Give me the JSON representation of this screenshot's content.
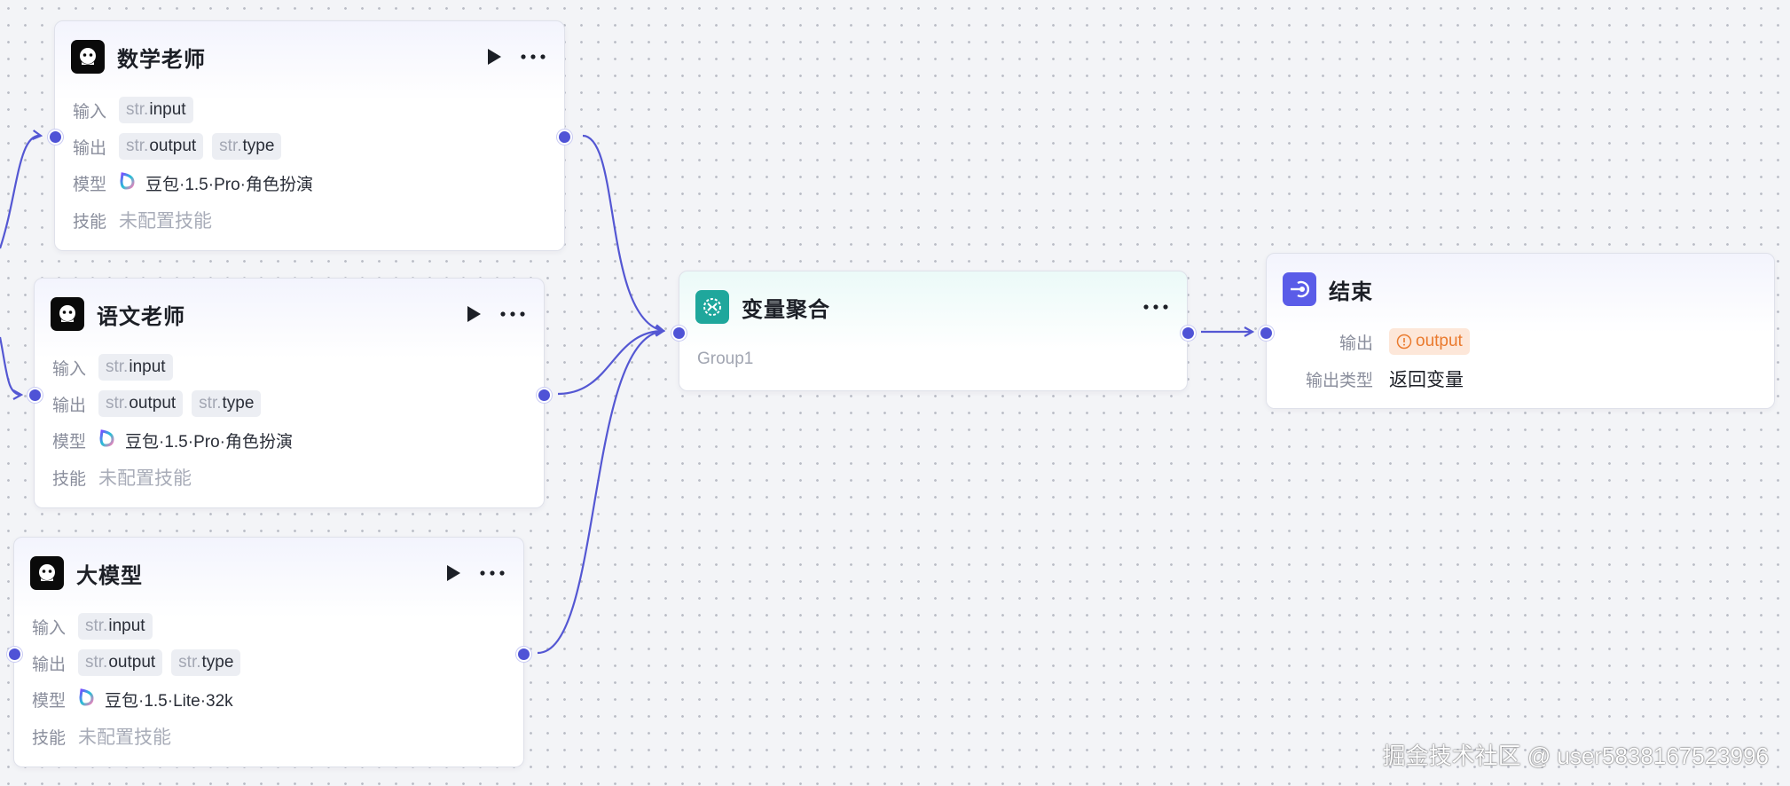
{
  "colors": {
    "accent": "#4f53d6",
    "edge": "#5457d3",
    "aggregate_icon": "#1fa79c",
    "end_icon": "#5a5ce8",
    "output_warning": "#ea7a2e"
  },
  "nodes": {
    "math_teacher": {
      "title": "数学老师",
      "input_label": "输入",
      "output_label": "输出",
      "model_label": "模型",
      "skill_label": "技能",
      "inputs": [
        {
          "type": "str.",
          "name": "input"
        }
      ],
      "outputs": [
        {
          "type": "str.",
          "name": "output"
        },
        {
          "type": "str.",
          "name": "type"
        }
      ],
      "model": "豆包·1.5·Pro·角色扮演",
      "skills": "未配置技能",
      "icon": "robot-face-icon"
    },
    "chinese_teacher": {
      "title": "语文老师",
      "input_label": "输入",
      "output_label": "输出",
      "model_label": "模型",
      "skill_label": "技能",
      "inputs": [
        {
          "type": "str.",
          "name": "input"
        }
      ],
      "outputs": [
        {
          "type": "str.",
          "name": "output"
        },
        {
          "type": "str.",
          "name": "type"
        }
      ],
      "model": "豆包·1.5·Pro·角色扮演",
      "skills": "未配置技能",
      "icon": "robot-face-icon"
    },
    "llm": {
      "title": "大模型",
      "input_label": "输入",
      "output_label": "输出",
      "model_label": "模型",
      "skill_label": "技能",
      "inputs": [
        {
          "type": "str.",
          "name": "input"
        }
      ],
      "outputs": [
        {
          "type": "str.",
          "name": "output"
        },
        {
          "type": "str.",
          "name": "type"
        }
      ],
      "model": "豆包·1.5·Lite·32k",
      "skills": "未配置技能",
      "icon": "robot-face-icon"
    },
    "aggregate": {
      "title": "变量聚合",
      "group": "Group1",
      "icon": "variable-aggregate-icon"
    },
    "end": {
      "title": "结束",
      "output_label": "输出",
      "output_value": "output",
      "output_type_label": "输出类型",
      "output_type": "返回变量",
      "icon": "end-exit-icon"
    }
  },
  "icons": {
    "run": "play-icon",
    "more": "more-dots-icon",
    "model": "doubao-model-icon",
    "warning": "warning-circle-icon"
  },
  "watermark": "掘金技术社区 @ user5838167523996"
}
